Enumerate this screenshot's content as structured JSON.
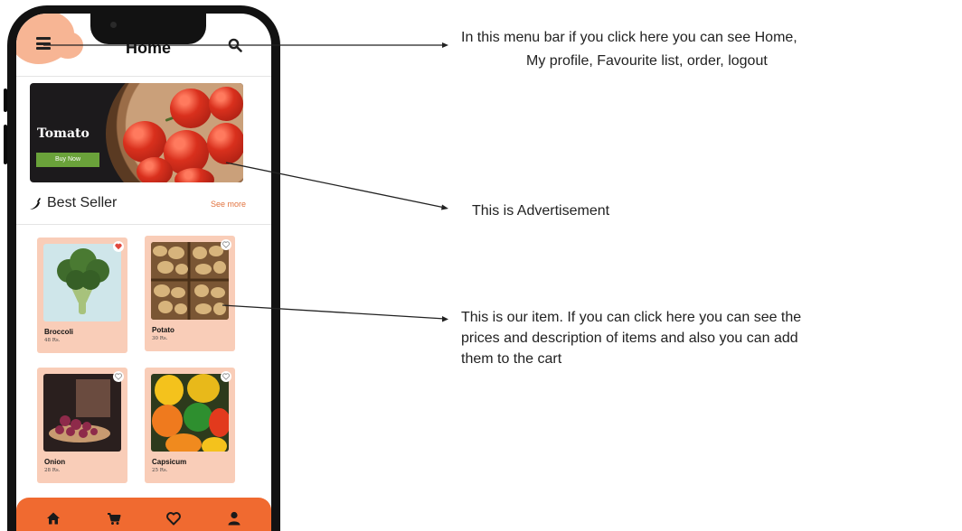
{
  "header": {
    "title": "Home",
    "menu_icon": "menu-icon",
    "search_icon": "search-icon"
  },
  "advertisement": {
    "title": "Tomato",
    "button_label": "Buy Now"
  },
  "best_seller": {
    "title": "Best Seller",
    "icon": "chili-icon",
    "see_more_label": "See more"
  },
  "items": [
    {
      "name": "Broccoli",
      "price": "48 Rs.",
      "favourite": true
    },
    {
      "name": "Potato",
      "price": "30 Rs.",
      "favourite": false
    },
    {
      "name": "Onion",
      "price": "28 Rs.",
      "favourite": false
    },
    {
      "name": "Capsicum",
      "price": "25 Rs.",
      "favourite": false
    }
  ],
  "bottom_nav": [
    "home-icon",
    "cart-icon",
    "heart-icon",
    "user-icon"
  ],
  "annotations": {
    "menu": {
      "line1": "In this menu bar  if you click here you can  see Home,",
      "line2": "My profile, Favourite list, order, logout"
    },
    "advertisement": "This is Advertisement",
    "item": {
      "line1": "This is our item. If you can click here  you can see  the",
      "line2": "prices and description of items and also you  can  add",
      "line3": "them to the cart"
    }
  },
  "colors": {
    "accent": "#f06a30",
    "card": "#f9cdb8",
    "blob": "#f7b594",
    "buy_button": "#6aa23a",
    "favourite_heart": "#e0473c"
  }
}
